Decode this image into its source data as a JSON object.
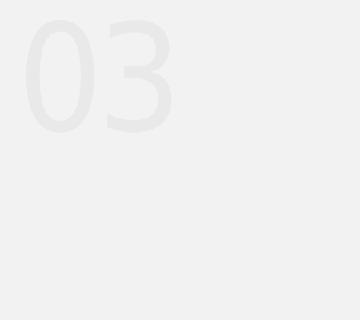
{
  "step": {
    "number": "03"
  },
  "colors": {
    "background": "#f2f2f2",
    "number": "#e9e9e9"
  }
}
